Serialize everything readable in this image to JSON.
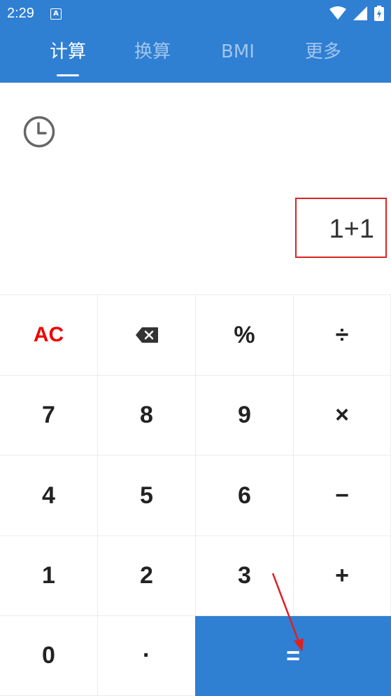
{
  "status_bar": {
    "time": "2:29",
    "icons": [
      "notification-a-icon",
      "wifi-icon",
      "signal-icon",
      "battery-charging-icon"
    ],
    "notification_letter": "A"
  },
  "tabs": [
    {
      "label": "计算",
      "active": true
    },
    {
      "label": "换算",
      "active": false
    },
    {
      "label": "BMI",
      "active": false
    },
    {
      "label": "更多",
      "active": false
    }
  ],
  "display": {
    "expression": "1+1"
  },
  "keys": {
    "ac": "AC",
    "backspace": "backspace-icon",
    "percent": "%",
    "divide": "÷",
    "seven": "7",
    "eight": "8",
    "nine": "9",
    "multiply": "×",
    "four": "4",
    "five": "5",
    "six": "6",
    "minus": "−",
    "one": "1",
    "two": "2",
    "three": "3",
    "plus": "+",
    "zero": "0",
    "dot": "·",
    "equals": "="
  },
  "colors": {
    "primary": "#2f7fd3",
    "ac_red": "#e00000",
    "annotation_red": "#dd2222"
  }
}
